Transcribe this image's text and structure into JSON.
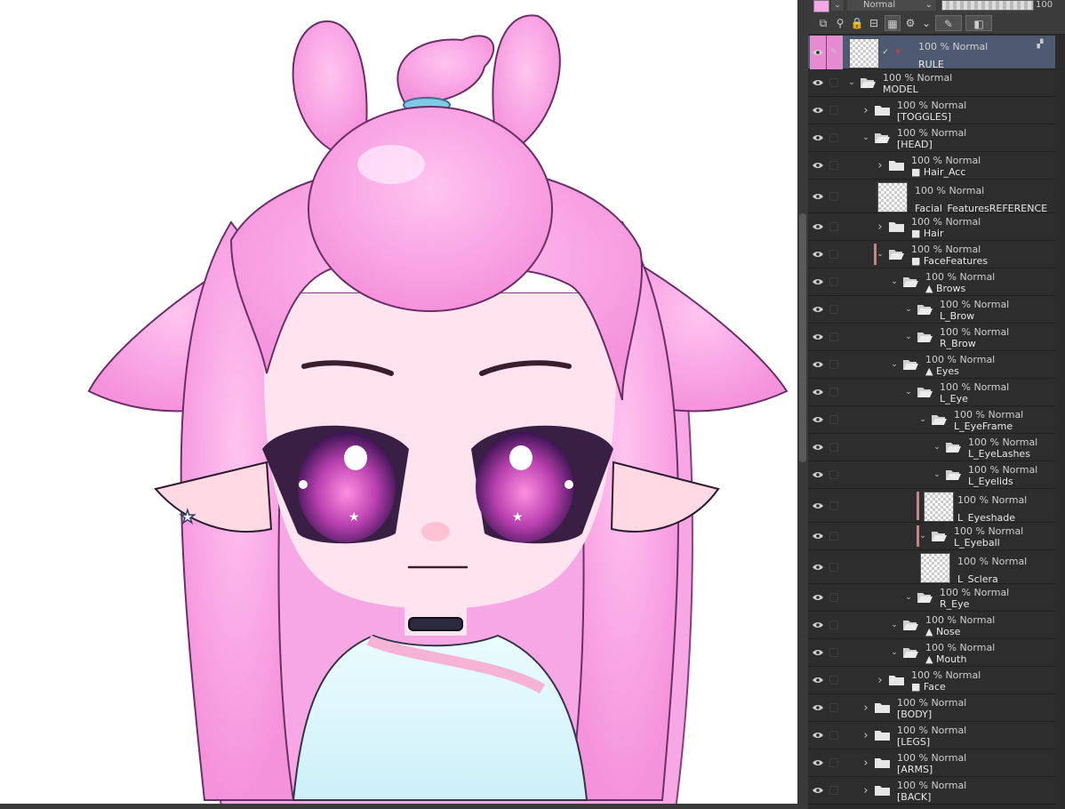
{
  "toolbar": {
    "blend_mode": "Normal",
    "opacity_value": "100"
  },
  "layers": [
    {
      "indent": 0,
      "type": "raster",
      "mode": "100 % Normal",
      "name": "RULE",
      "selected": true,
      "tall": true
    },
    {
      "indent": 0,
      "type": "folder",
      "open": true,
      "mode": "100 % Normal",
      "name": "MODEL"
    },
    {
      "indent": 1,
      "type": "folder",
      "open": false,
      "mode": "100 % Normal",
      "name": "[TOGGLES]"
    },
    {
      "indent": 1,
      "type": "folder",
      "open": true,
      "mode": "100 % Normal",
      "name": "[HEAD]"
    },
    {
      "indent": 2,
      "type": "folder",
      "open": false,
      "mode": "100 % Normal",
      "name": "■ Hair_Acc"
    },
    {
      "indent": 2,
      "type": "raster",
      "mode": "100 % Normal",
      "name": "Facial_FeaturesREFERENCE",
      "tall": true
    },
    {
      "indent": 2,
      "type": "folder",
      "open": false,
      "mode": "100 % Normal",
      "name": "■ Hair"
    },
    {
      "indent": 2,
      "type": "folder",
      "open": true,
      "mode": "100 % Normal",
      "name": "■ FaceFeatures",
      "red": true
    },
    {
      "indent": 3,
      "type": "folder",
      "open": true,
      "mode": "100 % Normal",
      "name": "▲ Brows"
    },
    {
      "indent": 4,
      "type": "folder",
      "open": true,
      "mode": "100 % Normal",
      "name": "L_Brow"
    },
    {
      "indent": 4,
      "type": "folder",
      "open": true,
      "mode": "100 % Normal",
      "name": "R_Brow"
    },
    {
      "indent": 3,
      "type": "folder",
      "open": true,
      "mode": "100 % Normal",
      "name": "▲ Eyes"
    },
    {
      "indent": 4,
      "type": "folder",
      "open": true,
      "mode": "100 % Normal",
      "name": "L_Eye"
    },
    {
      "indent": 5,
      "type": "folder",
      "open": true,
      "mode": "100 % Normal",
      "name": "L_EyeFrame"
    },
    {
      "indent": 6,
      "type": "folder",
      "open": true,
      "mode": "100 % Normal",
      "name": "L_EyeLashes"
    },
    {
      "indent": 6,
      "type": "folder",
      "open": true,
      "mode": "100 % Normal",
      "name": "L_Eyelids"
    },
    {
      "indent": 5,
      "type": "raster",
      "mode": "100 % Normal",
      "name": "L_Eyeshade",
      "tall": true,
      "red": true
    },
    {
      "indent": 5,
      "type": "folder",
      "open": true,
      "mode": "100 % Normal",
      "name": "L_Eyeball",
      "red": true
    },
    {
      "indent": 5,
      "type": "raster",
      "mode": "100 % Normal",
      "name": "L_Sclera",
      "tall": true
    },
    {
      "indent": 4,
      "type": "folder",
      "open": true,
      "mode": "100 % Normal",
      "name": "R_Eye"
    },
    {
      "indent": 3,
      "type": "folder",
      "open": true,
      "mode": "100 % Normal",
      "name": "▲ Nose"
    },
    {
      "indent": 3,
      "type": "folder",
      "open": true,
      "mode": "100 % Normal",
      "name": "▲ Mouth"
    },
    {
      "indent": 2,
      "type": "folder",
      "open": false,
      "mode": "100 % Normal",
      "name": "■ Face"
    },
    {
      "indent": 1,
      "type": "folder",
      "open": false,
      "mode": "100 % Normal",
      "name": "[BODY]"
    },
    {
      "indent": 1,
      "type": "folder",
      "open": false,
      "mode": "100 % Normal",
      "name": "[LEGS]"
    },
    {
      "indent": 1,
      "type": "folder",
      "open": false,
      "mode": "100 % Normal",
      "name": "[ARMS]"
    },
    {
      "indent": 1,
      "type": "folder",
      "open": false,
      "mode": "100 % Normal",
      "name": "[BACK]"
    }
  ]
}
